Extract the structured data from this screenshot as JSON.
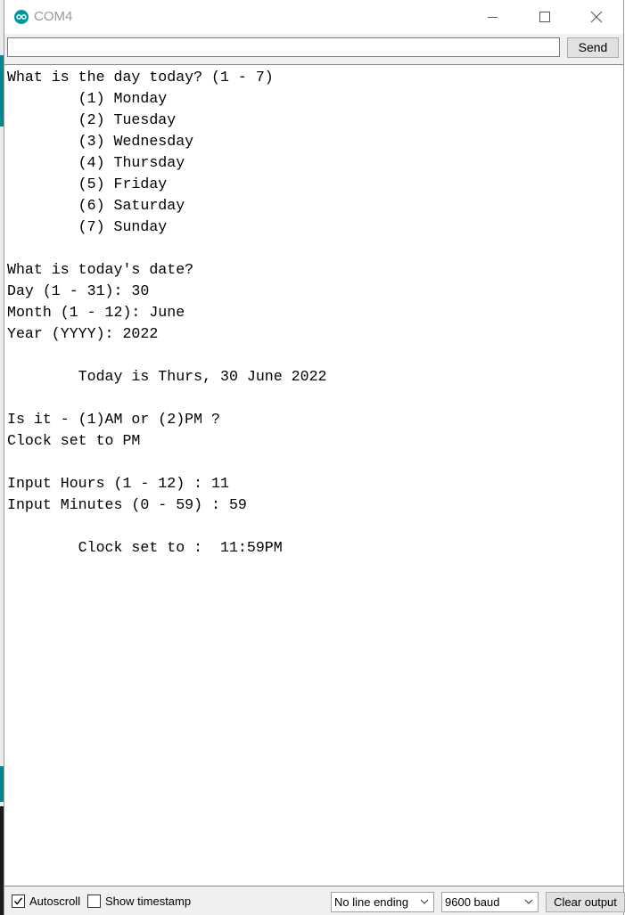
{
  "window": {
    "title": "COM4",
    "icon": "arduino-icon",
    "controls": [
      "minimize-icon",
      "maximize-icon",
      "close-icon"
    ]
  },
  "send_row": {
    "input_value": "",
    "send_label": "Send"
  },
  "output": {
    "lines": [
      "What is the day today? (1 - 7)",
      "        (1) Monday",
      "        (2) Tuesday",
      "        (3) Wednesday",
      "        (4) Thursday",
      "        (5) Friday",
      "        (6) Saturday",
      "        (7) Sunday",
      "",
      "What is today's date?",
      "Day (1 - 31): 30",
      "Month (1 - 12): June",
      "Year (YYYY): 2022",
      "",
      "        Today is Thurs, 30 June 2022",
      "",
      "Is it - (1)AM or (2)PM ?",
      "Clock set to PM",
      "",
      "Input Hours (1 - 12) : 11",
      "Input Minutes (0 - 59) : 59",
      "",
      "        Clock set to :  11:59PM"
    ]
  },
  "bottom_bar": {
    "autoscroll_label": "Autoscroll",
    "autoscroll_checked": true,
    "timestamp_label": "Show timestamp",
    "timestamp_checked": false,
    "line_ending": "No line ending",
    "baud_rate": "9600 baud",
    "clear_label": "Clear output"
  }
}
